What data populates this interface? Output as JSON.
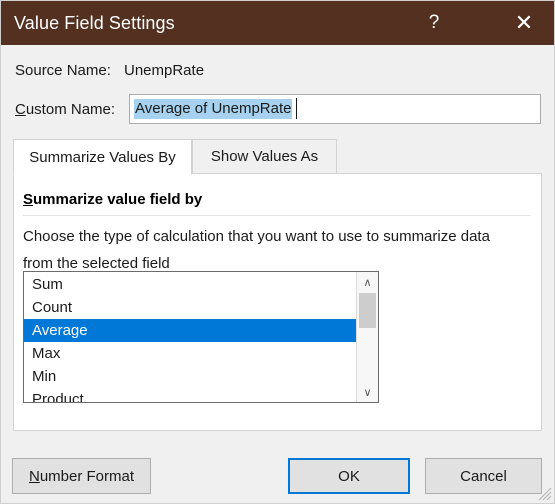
{
  "window": {
    "title": "Value Field Settings",
    "title_bar_color": "#53301f",
    "accent_color": "#0078d7",
    "help_icon": "question-mark-icon",
    "close_icon": "close-icon",
    "help_glyph": "?",
    "close_glyph": "✕"
  },
  "fields": {
    "source_name_label": "Source Name:",
    "source_name_value": "UnempRate",
    "custom_name_label_prefix": "C",
    "custom_name_label_rest": "ustom Name:",
    "custom_name_value": "Average of UnempRate",
    "custom_name_placeholder": "Custom Name"
  },
  "tabs": [
    {
      "label": "Summarize Values By",
      "active": true
    },
    {
      "label": "Show Values As",
      "active": false
    }
  ],
  "panel": {
    "heading_accel": "S",
    "heading_rest": "ummarize value field by",
    "description": "Choose the type of calculation that you want to use to summarize data from the selected field"
  },
  "listbox": {
    "items": [
      {
        "label": "Sum",
        "selected": false
      },
      {
        "label": "Count",
        "selected": false
      },
      {
        "label": "Average",
        "selected": true
      },
      {
        "label": "Max",
        "selected": false
      },
      {
        "label": "Min",
        "selected": false
      },
      {
        "label": "Product",
        "selected": false
      }
    ],
    "selected_value": "Average",
    "scroll_up_glyph": "∧",
    "scroll_down_glyph": "∨"
  },
  "buttons": {
    "number_format_accel": "N",
    "number_format_rest": "umber Format",
    "ok": "OK",
    "cancel": "Cancel"
  }
}
